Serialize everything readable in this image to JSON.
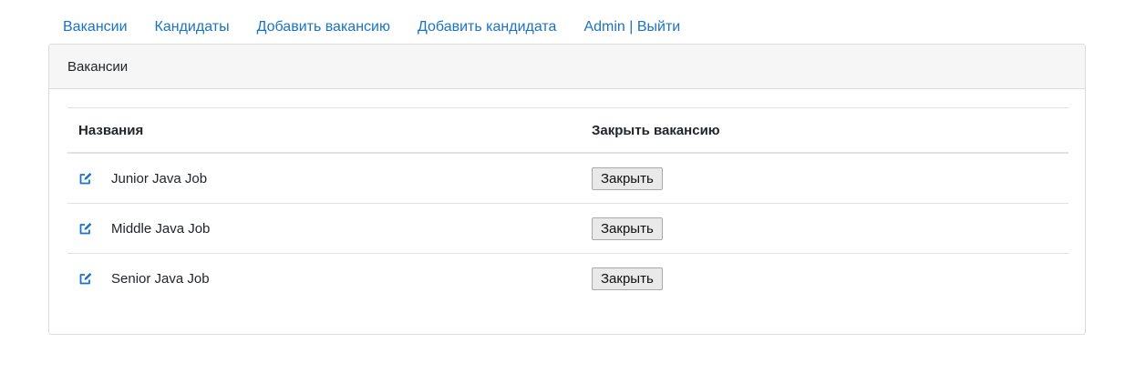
{
  "nav": {
    "items": [
      {
        "label": "Вакансии"
      },
      {
        "label": "Кандидаты"
      },
      {
        "label": "Добавить вакансию"
      },
      {
        "label": "Добавить кандидата"
      },
      {
        "label": "Admin | Выйти"
      }
    ]
  },
  "card": {
    "title": "Вакансии"
  },
  "table": {
    "headers": {
      "name": "Названия",
      "close": "Закрыть вакансию"
    },
    "rows": [
      {
        "name": "Junior Java Job",
        "button": "Закрыть",
        "icon": "edit-icon"
      },
      {
        "name": "Middle Java Job",
        "button": "Закрыть",
        "icon": "edit-icon"
      },
      {
        "name": "Senior Java Job",
        "button": "Закрыть",
        "icon": "edit-icon"
      }
    ]
  },
  "colors": {
    "link": "#1a73c6",
    "header_bg": "#f6f6f6",
    "border": "#dcdcdc"
  }
}
